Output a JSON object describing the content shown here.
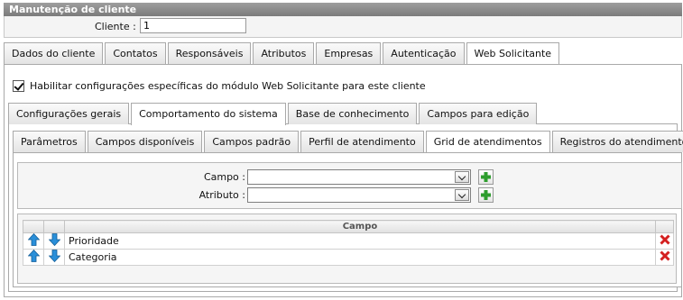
{
  "window": {
    "title": "Manutenção de cliente"
  },
  "client": {
    "label": "Cliente :",
    "value": "1"
  },
  "main_tabs": [
    {
      "label": "Dados do cliente",
      "active": false
    },
    {
      "label": "Contatos",
      "active": false
    },
    {
      "label": "Responsáveis",
      "active": false
    },
    {
      "label": "Atributos",
      "active": false
    },
    {
      "label": "Empresas",
      "active": false
    },
    {
      "label": "Autenticação",
      "active": false
    },
    {
      "label": "Web Solicitante",
      "active": true
    }
  ],
  "enable_specific": {
    "label": "Habilitar configurações específicas do módulo Web Solicitante para este cliente",
    "checked": true
  },
  "sub_tabs": [
    {
      "label": "Configurações gerais",
      "active": false
    },
    {
      "label": "Comportamento do sistema",
      "active": true
    },
    {
      "label": "Base de conhecimento",
      "active": false
    },
    {
      "label": "Campos para edição",
      "active": false
    }
  ],
  "inner_tabs": [
    {
      "label": "Parâmetros",
      "active": false
    },
    {
      "label": "Campos disponíveis",
      "active": false
    },
    {
      "label": "Campos padrão",
      "active": false
    },
    {
      "label": "Perfil de atendimento",
      "active": false
    },
    {
      "label": "Grid de atendimentos",
      "active": true
    },
    {
      "label": "Registros do atendimento",
      "active": false
    }
  ],
  "form": {
    "campo_label": "Campo :",
    "campo_value": "",
    "atributo_label": "Atributo :",
    "atributo_value": ""
  },
  "grid": {
    "column_header": "Campo",
    "rows": [
      {
        "campo": "Prioridade"
      },
      {
        "campo": "Categoria"
      }
    ]
  },
  "colors": {
    "title_bg": "#8a8a8a",
    "arrow_blue": "#2a8fd9",
    "add_green": "#2e9d2e",
    "delete_red": "#d42020"
  },
  "icons": [
    "arrow-up-icon",
    "arrow-down-icon",
    "add-icon",
    "delete-icon",
    "checkmark-icon",
    "chevron-down-icon"
  ]
}
